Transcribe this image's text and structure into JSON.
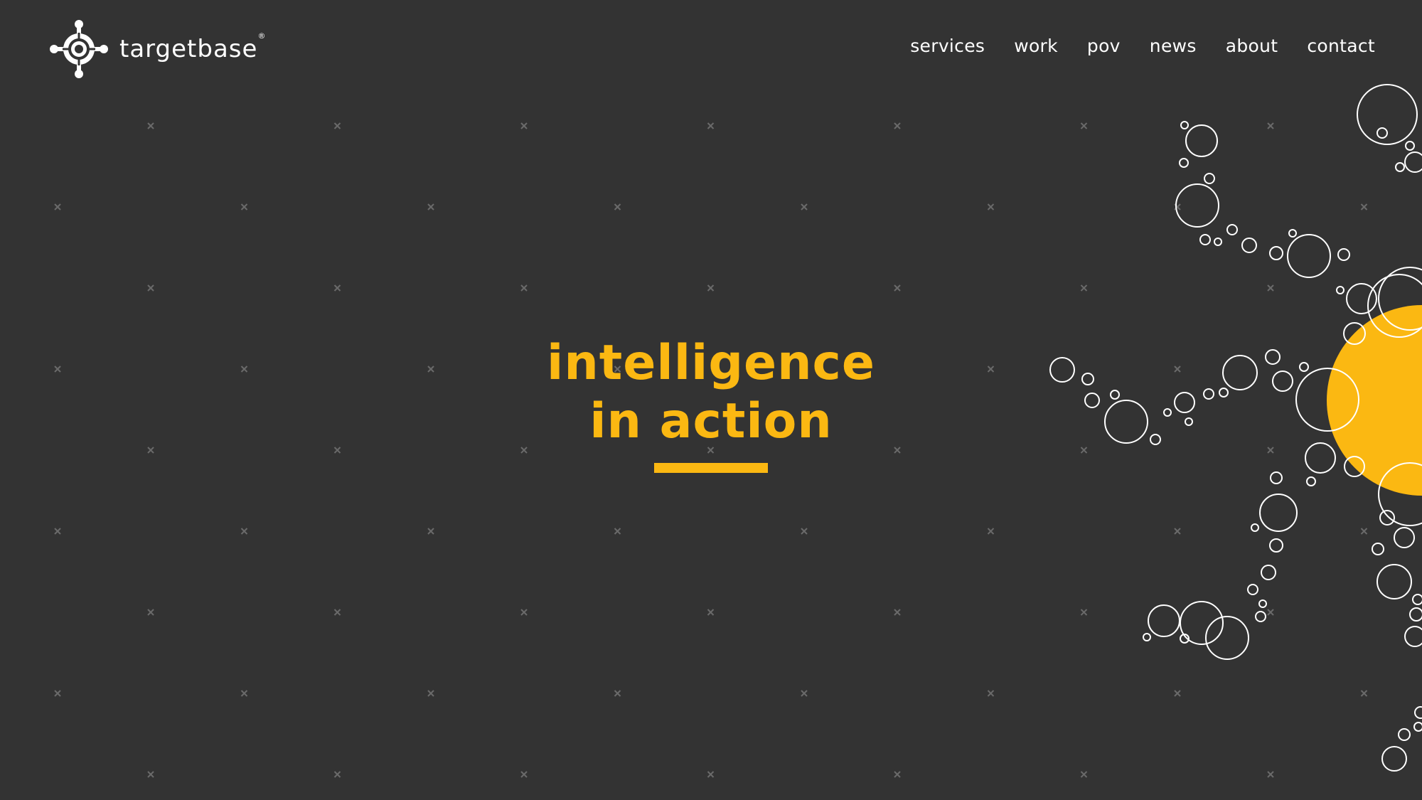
{
  "brand": {
    "name": "targetbase",
    "mark": "®"
  },
  "nav": {
    "items": [
      "services",
      "work",
      "pov",
      "news",
      "about",
      "contact"
    ]
  },
  "hero": {
    "line1": "intelligence",
    "line2": "in action"
  },
  "colors": {
    "background": "#333333",
    "accent": "#fbb812",
    "text": "#ffffff",
    "pattern": "#6a6a6a"
  },
  "icons": {
    "logo": "target-crosshair-icon",
    "pattern": "x-mark-icon"
  }
}
